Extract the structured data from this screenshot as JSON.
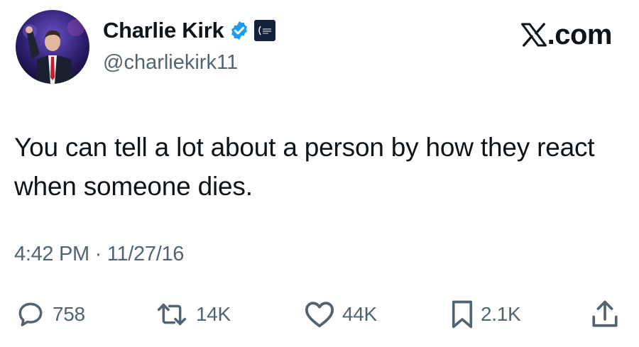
{
  "author": {
    "display_name": "Charlie Kirk",
    "handle": "@charliekirk11",
    "verified_icon": "verified-badge-icon",
    "affiliation_icon": "affiliate-logo-icon"
  },
  "brand": {
    "suffix": ".com",
    "icon": "x-logo-icon"
  },
  "tweet": {
    "text": "You can tell a lot about a person by how they react when someone dies.",
    "timestamp": "4:42 PM · 11/27/16"
  },
  "actions": {
    "replies": "758",
    "retweets": "14K",
    "likes": "44K",
    "bookmarks": "2.1K"
  },
  "colors": {
    "text": "#0f1419",
    "secondary": "#536471",
    "verified_blue": "#1d9bf0"
  }
}
